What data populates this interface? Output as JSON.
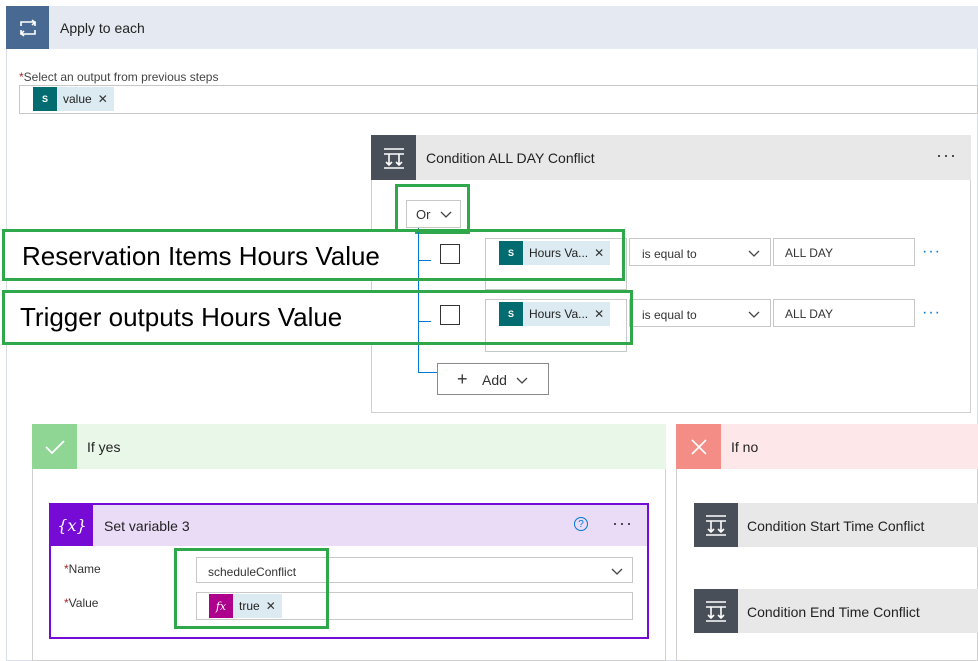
{
  "apply_each": {
    "title": "Apply to each",
    "select_label": "Select an output from previous steps",
    "token_label": "value",
    "token_icon": "sharepoint-icon"
  },
  "condition": {
    "title": "Condition ALL DAY Conflict",
    "operator": "Or",
    "rows": [
      {
        "token": "Hours Va...",
        "operator": "is equal to",
        "value": "ALL DAY"
      },
      {
        "token": "Hours Va...",
        "operator": "is equal to",
        "value": "ALL DAY"
      }
    ],
    "add_label": "Add"
  },
  "annotations": {
    "row1": "Reservation Items Hours Value",
    "row2": "Trigger outputs Hours Value"
  },
  "if_yes": {
    "title": "If yes"
  },
  "set_variable": {
    "title": "Set variable 3",
    "name_label": "Name",
    "name_value": "scheduleConflict",
    "value_label": "Value",
    "value_token": "true"
  },
  "if_no": {
    "title": "If no",
    "cards": [
      {
        "title": "Condition Start Time Conflict"
      },
      {
        "title": "Condition End Time Conflict"
      }
    ]
  },
  "colors": {
    "accent": "#0078d4",
    "green": "#2ea84a",
    "yes": "#8fd694",
    "no": "#f38d85",
    "variable": "#770bd6"
  }
}
